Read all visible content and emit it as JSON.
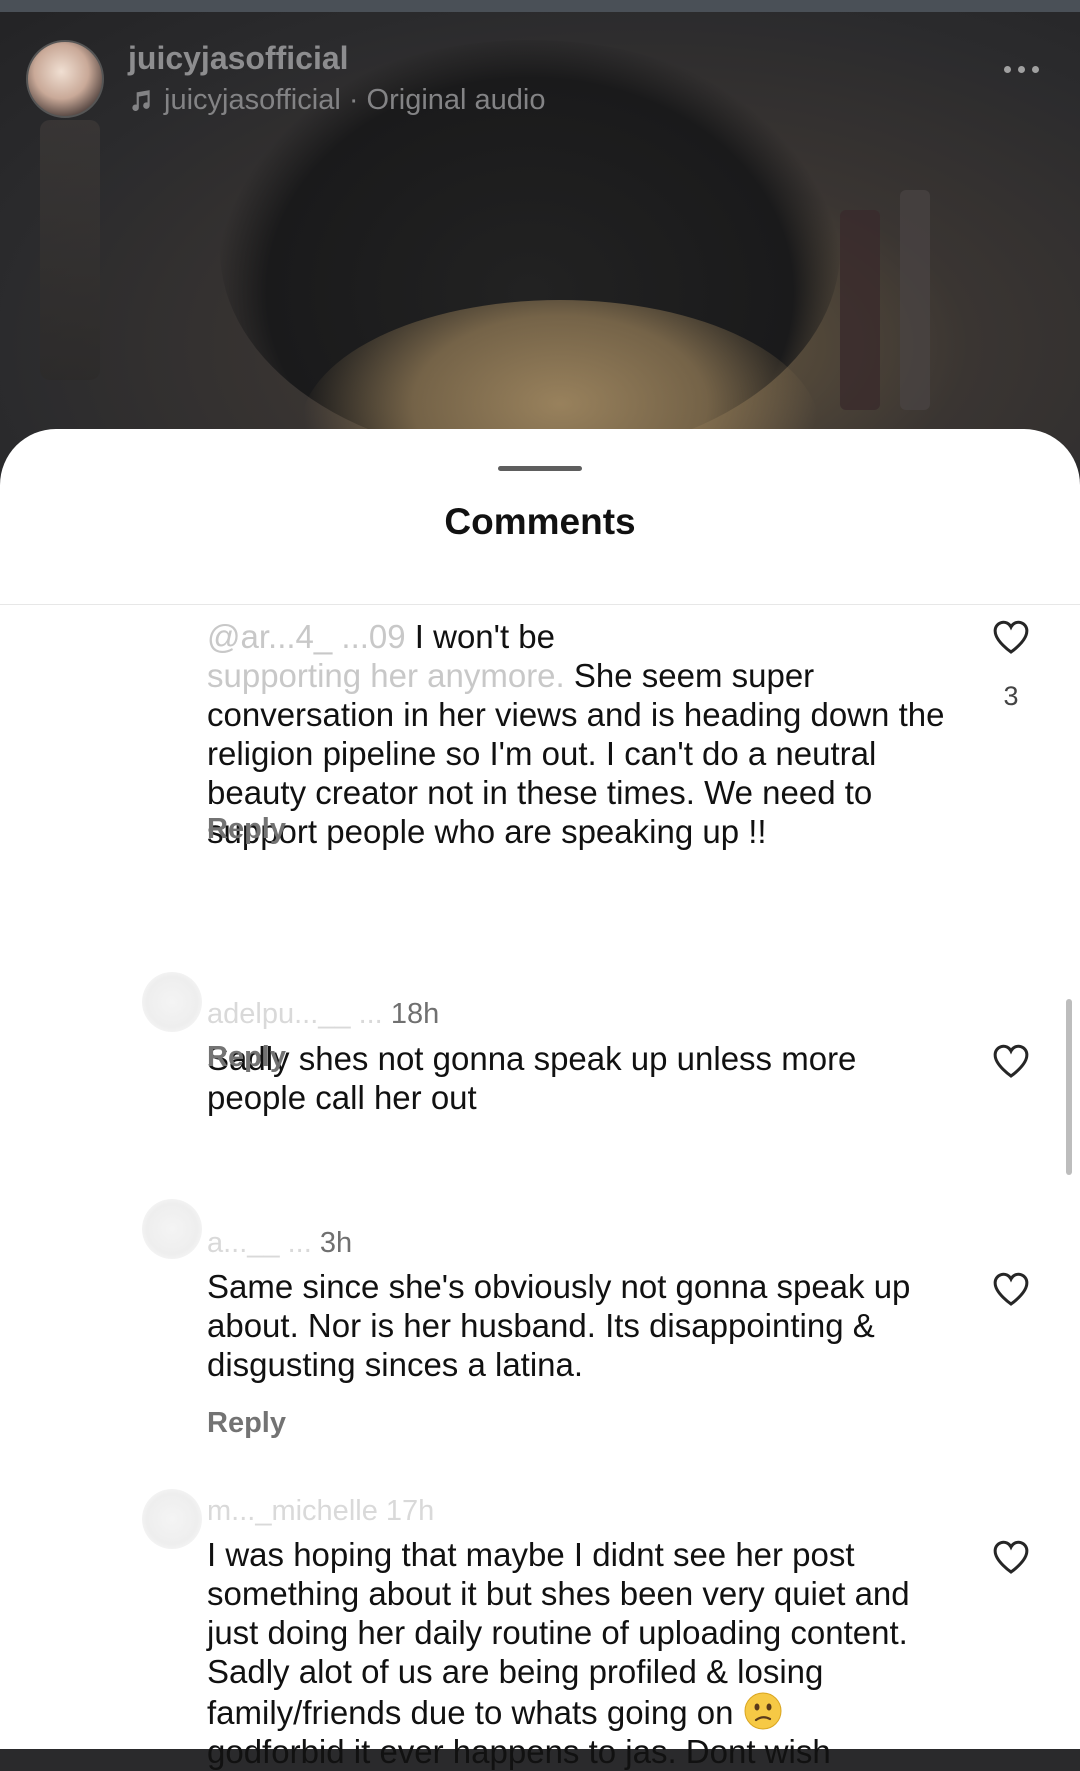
{
  "post": {
    "username": "juicyjasofficial",
    "audio_label": "juicyjasofficial · Original audio",
    "more_icon": "more-horizontal-icon"
  },
  "sheet": {
    "title": "Comments"
  },
  "comments": [
    {
      "meta_faded": "",
      "time": "",
      "text_faded": "supporting her anymore.",
      "first_line": "I won't be",
      "text": "She seem super conversation in her views and is heading down the religion pipeline so I'm out.  I can't do a neutral beauty creator not in these times.  We need to support people who are speaking up !!",
      "reply": "Reply",
      "likes": "3"
    },
    {
      "meta_faded": "adelpu...__ ...",
      "time": "18h",
      "text": "Sadly shes not gonna speak up unless more people call her out",
      "reply": "Reply"
    },
    {
      "meta_faded": "a...__ ...",
      "time": "3h",
      "text": "Same since she's obviously not gonna speak up about. Nor is her husband. Its disappointing & disgusting sinces a latina.",
      "reply": "Reply"
    },
    {
      "meta_faded": "m..._michelle 17h",
      "time": "",
      "text": "I was hoping that maybe I didnt see her post something about it but shes been very quiet and just doing her daily routine of uploading content. Sadly alot of us are being profiled & losing family/friends due to whats going on",
      "text_cut": "godforbid it ever happens to jas. Dont wish",
      "emoji": "confused-face"
    }
  ],
  "colors": {
    "sheet_bg": "#ffffff",
    "text": "#111111",
    "secondary": "#737373"
  }
}
